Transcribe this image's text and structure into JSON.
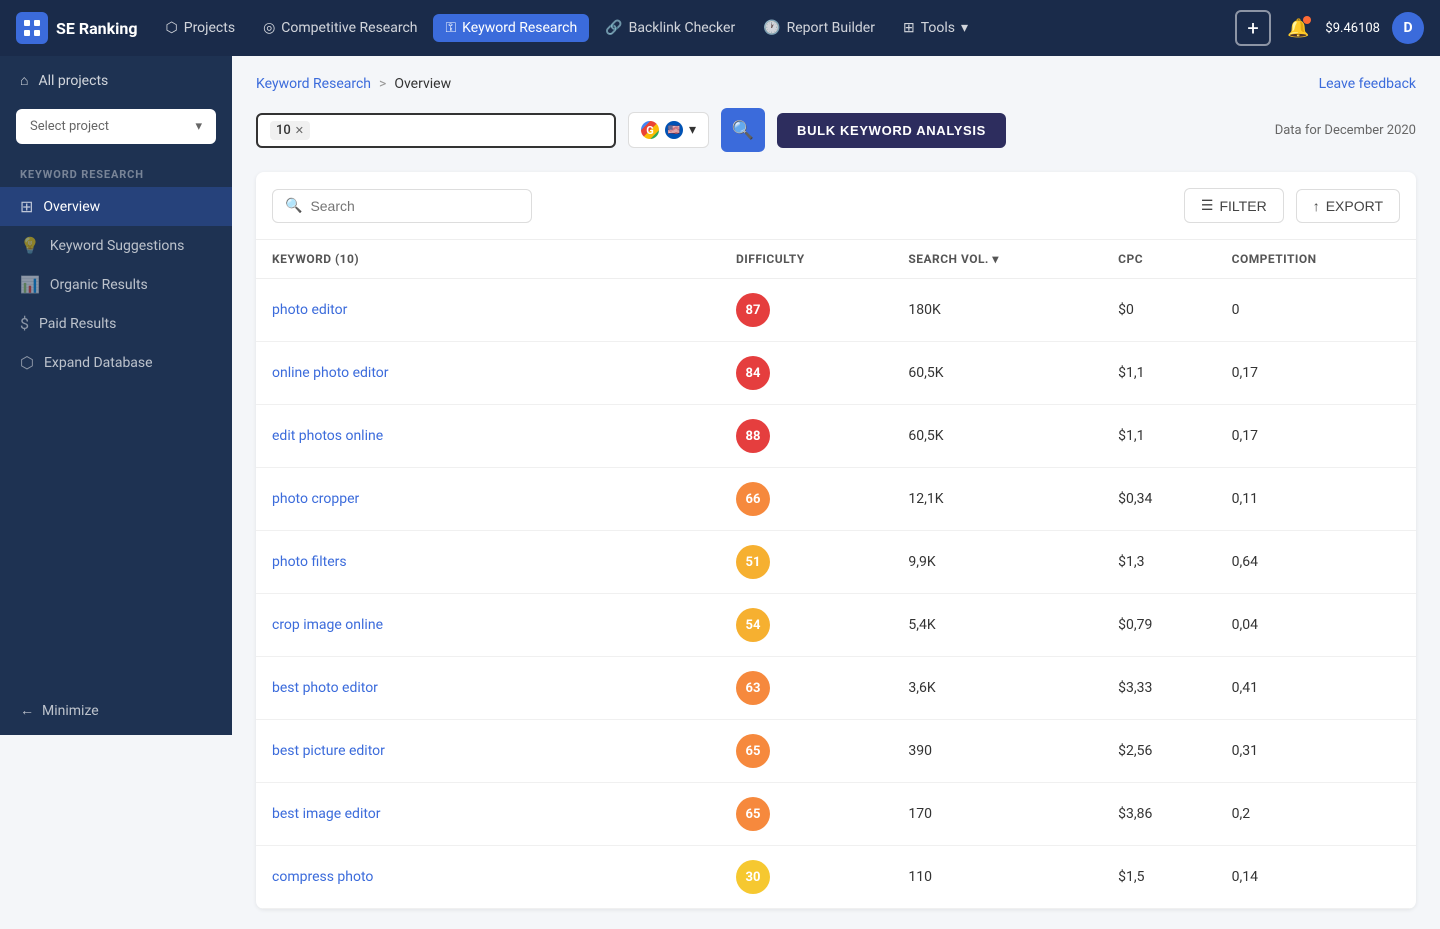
{
  "topnav": {
    "logo_text": "SE Ranking",
    "nav_items": [
      {
        "id": "projects",
        "label": "Projects",
        "icon": "layers",
        "active": false
      },
      {
        "id": "competitive",
        "label": "Competitive Research",
        "icon": "target",
        "active": false
      },
      {
        "id": "keyword",
        "label": "Keyword Research",
        "icon": "key",
        "active": true
      },
      {
        "id": "backlink",
        "label": "Backlink Checker",
        "icon": "link",
        "active": false
      },
      {
        "id": "report",
        "label": "Report Builder",
        "icon": "clock",
        "active": false
      },
      {
        "id": "tools",
        "label": "Tools",
        "icon": "grid",
        "active": false
      }
    ],
    "balance": "$9.46108",
    "avatar_letter": "D",
    "add_btn_label": "+"
  },
  "sidebar": {
    "all_projects_label": "All projects",
    "select_project_placeholder": "Select project",
    "section_label": "KEYWORD RESEARCH",
    "nav_items": [
      {
        "id": "overview",
        "label": "Overview",
        "icon": "grid",
        "active": true
      },
      {
        "id": "suggestions",
        "label": "Keyword Suggestions",
        "icon": "bulb",
        "active": false
      },
      {
        "id": "organic",
        "label": "Organic Results",
        "icon": "chart",
        "active": false
      },
      {
        "id": "paid",
        "label": "Paid Results",
        "icon": "dollar",
        "active": false
      },
      {
        "id": "expand",
        "label": "Expand Database",
        "icon": "expand",
        "active": false
      }
    ],
    "minimize_label": "Minimize"
  },
  "breadcrumb": {
    "root": "Keyword Research",
    "separator": ">",
    "current": "Overview"
  },
  "leave_feedback": "Leave feedback",
  "search_area": {
    "keyword_tag": "10",
    "bulk_btn_label": "BULK KEYWORD ANALYSIS",
    "data_for": "Data for December 2020"
  },
  "table": {
    "search_placeholder": "Search",
    "filter_label": "FILTER",
    "export_label": "EXPORT",
    "col_keyword": "KEYWORD (10)",
    "col_difficulty": "DIFFICULTY",
    "col_search_vol": "SEARCH VOL.",
    "col_cpc": "CPC",
    "col_competition": "COMPETITION",
    "rows": [
      {
        "keyword": "photo editor",
        "difficulty": 87,
        "diff_class": "diff-red",
        "search_vol": "180K",
        "cpc": "$0",
        "competition": "0"
      },
      {
        "keyword": "online photo editor",
        "difficulty": 84,
        "diff_class": "diff-red",
        "search_vol": "60,5K",
        "cpc": "$1,1",
        "competition": "0,17"
      },
      {
        "keyword": "edit photos online",
        "difficulty": 88,
        "diff_class": "diff-red",
        "search_vol": "60,5K",
        "cpc": "$1,1",
        "competition": "0,17"
      },
      {
        "keyword": "photo cropper",
        "difficulty": 66,
        "diff_class": "diff-orange",
        "search_vol": "12,1K",
        "cpc": "$0,34",
        "competition": "0,11"
      },
      {
        "keyword": "photo filters",
        "difficulty": 51,
        "diff_class": "diff-yellow-orange",
        "search_vol": "9,9K",
        "cpc": "$1,3",
        "competition": "0,64"
      },
      {
        "keyword": "crop image online",
        "difficulty": 54,
        "diff_class": "diff-yellow-orange",
        "search_vol": "5,4K",
        "cpc": "$0,79",
        "competition": "0,04"
      },
      {
        "keyword": "best photo editor",
        "difficulty": 63,
        "diff_class": "diff-orange",
        "search_vol": "3,6K",
        "cpc": "$3,33",
        "competition": "0,41"
      },
      {
        "keyword": "best picture editor",
        "difficulty": 65,
        "diff_class": "diff-orange",
        "search_vol": "390",
        "cpc": "$2,56",
        "competition": "0,31"
      },
      {
        "keyword": "best image editor",
        "difficulty": 65,
        "diff_class": "diff-orange",
        "search_vol": "170",
        "cpc": "$3,86",
        "competition": "0,2"
      },
      {
        "keyword": "compress photo",
        "difficulty": 30,
        "diff_class": "diff-yellow",
        "search_vol": "110",
        "cpc": "$1,5",
        "competition": "0,14"
      }
    ]
  }
}
